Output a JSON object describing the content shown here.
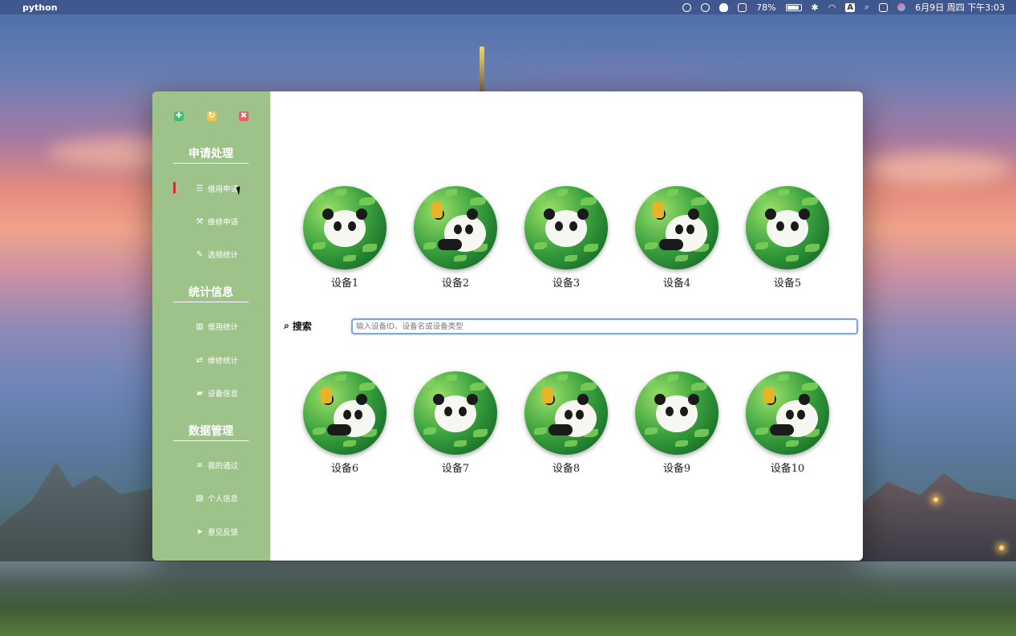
{
  "menubar": {
    "app_name": "python",
    "battery": "78%",
    "input_method": "A",
    "datetime": "6月9日 周四 下午3:03"
  },
  "window": {
    "controls": [
      "expand-icon",
      "refresh-icon",
      "close-icon"
    ],
    "control_colors": {
      "expand": "#3cc06a",
      "refresh": "#f3c54b",
      "close": "#ef5a6f"
    }
  },
  "sidebar": {
    "bg_color": "#9dc38a",
    "sections": [
      {
        "title": "申请处理",
        "items": [
          {
            "icon": "list-icon",
            "glyph": "☰",
            "label": "借用申请",
            "active": true
          },
          {
            "icon": "wrench-icon",
            "glyph": "🔧",
            "label": "维修申请"
          },
          {
            "icon": "edit-icon",
            "glyph": "✎",
            "label": "选频统计"
          }
        ]
      },
      {
        "title": "统计信息",
        "items": [
          {
            "icon": "bar-chart-icon",
            "glyph": "▥",
            "label": "借用统计"
          },
          {
            "icon": "exchange-icon",
            "glyph": "⇄",
            "label": "维修统计"
          },
          {
            "icon": "folder-icon",
            "glyph": "▰",
            "label": "设备信息"
          }
        ]
      },
      {
        "title": "数据管理",
        "items": [
          {
            "icon": "list-ol-icon",
            "glyph": "≡",
            "label": "我的通过"
          },
          {
            "icon": "map-icon",
            "glyph": "▧",
            "label": "个人信息"
          },
          {
            "icon": "send-icon",
            "glyph": "➤",
            "label": "意见反馈"
          }
        ]
      }
    ]
  },
  "main": {
    "search": {
      "label": "搜索",
      "placeholder": "输入设备ID、设备名或设备类型",
      "value": ""
    },
    "devices_row1": [
      {
        "label": "设备1",
        "variant": "panda"
      },
      {
        "label": "设备2",
        "variant": "person"
      },
      {
        "label": "设备3",
        "variant": "panda"
      },
      {
        "label": "设备4",
        "variant": "person"
      },
      {
        "label": "设备5",
        "variant": "panda"
      }
    ],
    "devices_row2": [
      {
        "label": "设备6",
        "variant": "person"
      },
      {
        "label": "设备7",
        "variant": "panda"
      },
      {
        "label": "设备8",
        "variant": "person"
      },
      {
        "label": "设备9",
        "variant": "panda"
      },
      {
        "label": "设备10",
        "variant": "person"
      }
    ]
  }
}
